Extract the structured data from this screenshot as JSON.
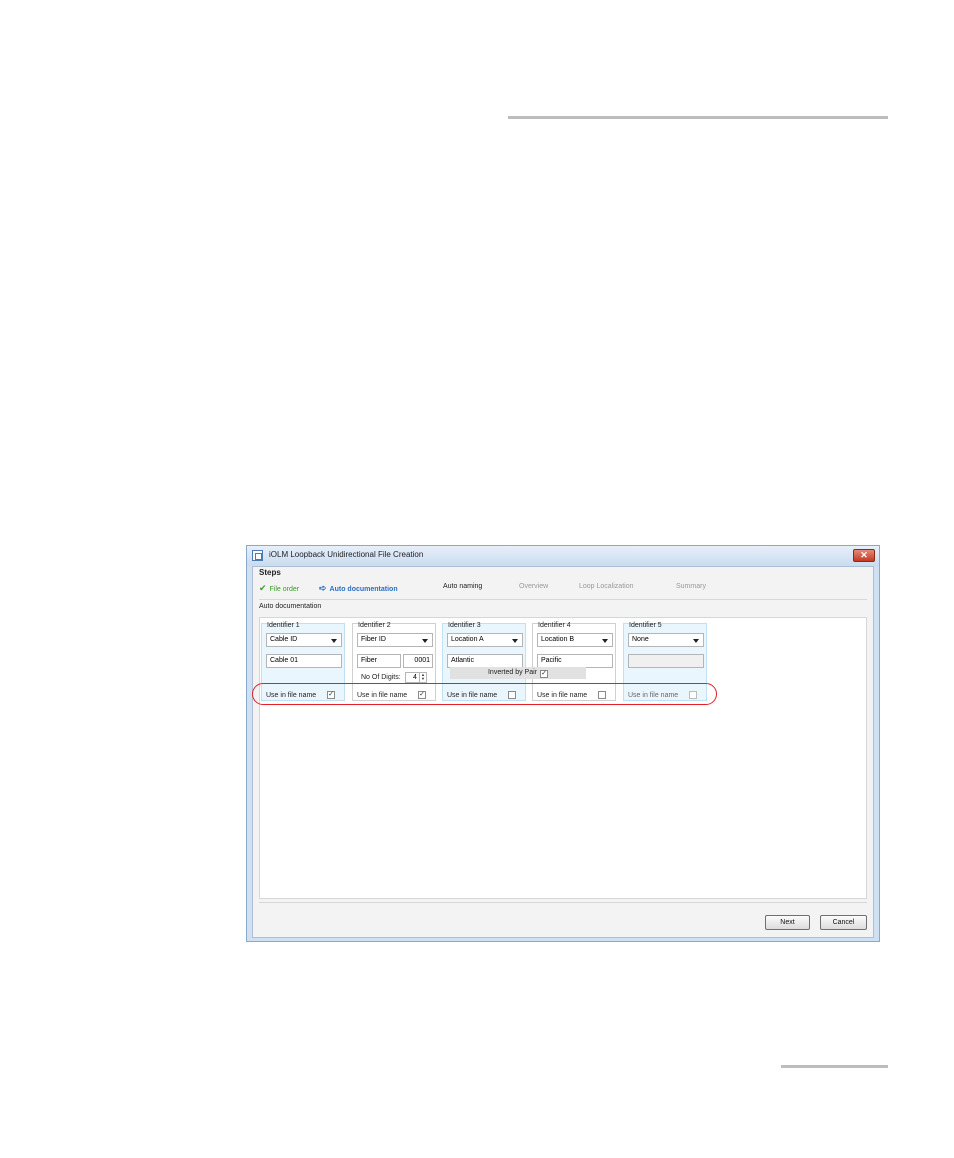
{
  "window": {
    "title": "iOLM Loopback Unidirectional File Creation",
    "close_symbol": "✕"
  },
  "steps": {
    "label": "Steps",
    "items": [
      {
        "label": "File order",
        "state": "done",
        "icon": "check-icon"
      },
      {
        "label": "Auto documentation",
        "state": "current",
        "icon": "arrow-right-icon"
      },
      {
        "label": "Auto naming",
        "state": "next"
      },
      {
        "label": "Overview",
        "state": "pending"
      },
      {
        "label": "Loop Localization",
        "state": "pending"
      },
      {
        "label": "Summary",
        "state": "pending"
      }
    ]
  },
  "section_label": "Auto documentation",
  "identifiers": [
    {
      "legend": "Identifier 1",
      "dropdown": "Cable ID",
      "value": "Cable 01",
      "use_label": "Use in file name",
      "checked": true
    },
    {
      "legend": "Identifier 2",
      "dropdown": "Fiber ID",
      "value": "Fiber",
      "number": "0001",
      "digits_label": "No Of Digits:",
      "digits": "4",
      "use_label": "Use in file name",
      "checked": true
    },
    {
      "legend": "Identifier 3",
      "dropdown": "Location A",
      "value": "Atlantic",
      "use_label": "Use in file name",
      "checked": false
    },
    {
      "legend": "Identifier 4",
      "dropdown": "Location B",
      "value": "Pacific",
      "use_label": "Use in file name",
      "checked": false
    },
    {
      "legend": "Identifier 5",
      "dropdown": "None",
      "value": "",
      "use_label": "Use in file name",
      "checked": false
    }
  ],
  "inverted_by_pair": {
    "label": "Inverted by Pair",
    "checked": true
  },
  "check_mark": "✓",
  "buttons": {
    "next": "Next",
    "cancel": "Cancel"
  },
  "colors": {
    "highlight": "#e0202a",
    "done_step": "#3a9a2a",
    "current_step": "#2a6fc0"
  }
}
